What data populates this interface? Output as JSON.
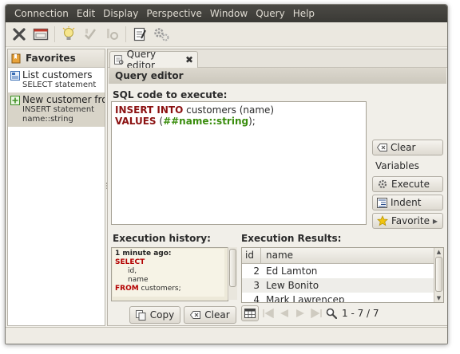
{
  "menu": [
    "Connection",
    "Edit",
    "Display",
    "Perspective",
    "Window",
    "Query",
    "Help"
  ],
  "toolbar": {
    "icons": [
      "disconnect-icon",
      "window-icon",
      "lightbulb-icon",
      "commit-icon",
      "rollback-icon",
      "edit-icon",
      "settings-icon"
    ]
  },
  "favorites": {
    "title": "Favorites",
    "items": [
      {
        "name": "List customers",
        "detail": "SELECT statement",
        "selected": false
      },
      {
        "name": "New customer fron",
        "detail": "INSERT statement",
        "detail2": "name::string",
        "selected": true
      }
    ]
  },
  "editor": {
    "tab_label": "Query editor",
    "panel_title": "Query editor",
    "sql_label": "SQL code to execute:",
    "sql": {
      "line1_kw": "INSERT INTO",
      "line1_rest": " customers (name)",
      "line2_kw": "VALUES",
      "line2_open": " (",
      "line2_param": "##name::string",
      "line2_close": ");"
    },
    "buttons": {
      "clear": "Clear",
      "variables": "Variables",
      "execute": "Execute",
      "indent": "Indent",
      "favorite": "Favorite"
    }
  },
  "history": {
    "label": "Execution history:",
    "entry": {
      "ago": "1 minute ago:",
      "kw_select": "SELECT",
      "col1": "id,",
      "col2": "name",
      "kw_from": "FROM",
      "table": " customers;"
    },
    "copy_label": "Copy",
    "clear_label": "Clear"
  },
  "results": {
    "label": "Execution Results:",
    "columns": [
      "id",
      "name"
    ],
    "rows": [
      {
        "id": "2",
        "name": "Ed Lamton"
      },
      {
        "id": "3",
        "name": "Lew Bonito"
      },
      {
        "id": "4",
        "name": "Mark Lawrencep"
      }
    ],
    "count": "1 - 7 / 7"
  }
}
